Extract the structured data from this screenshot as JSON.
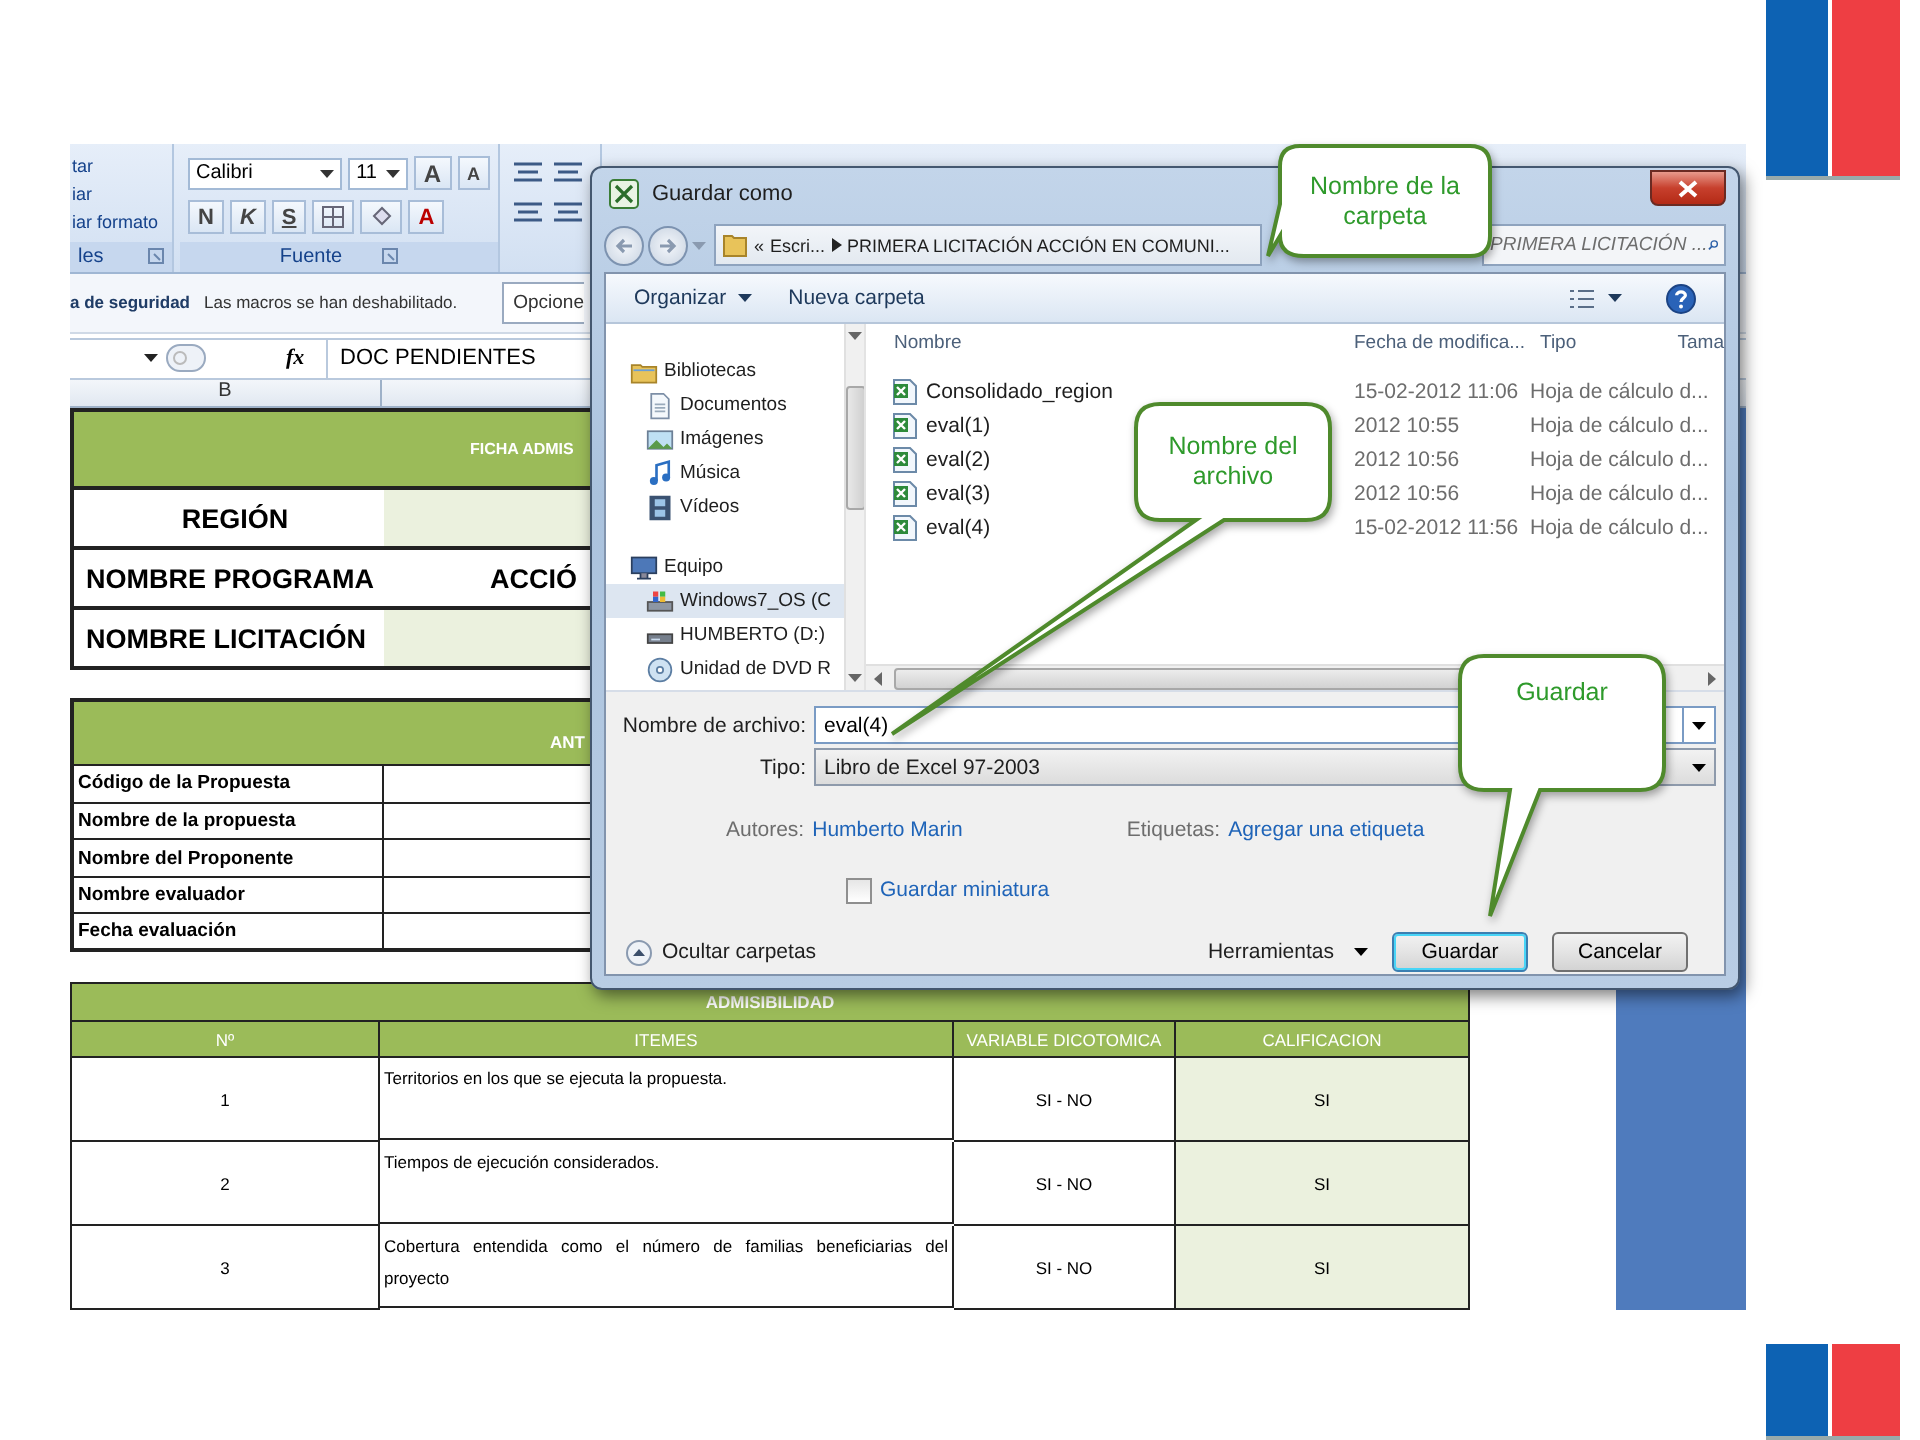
{
  "excel": {
    "ribbon": {
      "clipboard": {
        "items": [
          "tar",
          "iar",
          "iar formato"
        ],
        "label": "les"
      },
      "font": {
        "name": "Calibri",
        "size": "11",
        "grow": "A",
        "shrink": "A",
        "bold": "N",
        "italic": "K",
        "underline": "S",
        "font_color": "A",
        "label": "Fuente"
      }
    },
    "security_bar": {
      "title": "a de seguridad",
      "message": "Las macros se han deshabilitado.",
      "button": "Opcione"
    },
    "formula_bar": {
      "function_label": "fx",
      "content": "DOC PENDIENTES"
    },
    "column_header": "B",
    "ficha": {
      "title": "FICHA ADMIS",
      "rows": [
        {
          "label": "REGIÓN",
          "filled": true
        },
        {
          "label": "NOMBRE PROGRAMA",
          "value": "ACCIÓ",
          "filled": false
        },
        {
          "label": "NOMBRE LICITACIÓN",
          "filled": true
        }
      ]
    },
    "antecedentes": {
      "title": "ANT",
      "rows": [
        "Código de la Propuesta",
        "Nombre de la propuesta",
        "Nombre del Proponente",
        "Nombre evaluador",
        "Fecha evaluación"
      ]
    },
    "admisibilidad": {
      "title": "ADMISIBILIDAD",
      "columns": [
        "Nº",
        "ITEMES",
        "VARIABLE DICOTOMICA",
        "CALIFICACION"
      ],
      "rows": [
        {
          "number": "1",
          "item": "Territorios en los que se ejecuta la propuesta.",
          "variable": "SI - NO",
          "grade": "SI"
        },
        {
          "number": "2",
          "item": "Tiempos de ejecución considerados.",
          "variable": "SI - NO",
          "grade": "SI"
        },
        {
          "number": "3",
          "item": "Cobertura entendida como el número de familias beneficiarias del proyecto",
          "variable": "SI - NO",
          "grade": "SI"
        }
      ]
    }
  },
  "dialog": {
    "title": "Guardar como",
    "address": {
      "overflow": "«",
      "crumbs": [
        "Escri...",
        "PRIMERA LICITACIÓN ACCIÓN EN COMUNI..."
      ]
    },
    "search_placeholder": "PRIMERA LICITACIÓN ...",
    "toolbar": [
      {
        "label": "Organizar",
        "menu": true
      },
      {
        "label": "Nueva carpeta",
        "menu": false
      }
    ],
    "nav": [
      {
        "label": "Bibliotecas",
        "kind": "library",
        "selected": false,
        "children": [
          {
            "label": "Documentos",
            "kind": "documents",
            "selected": false
          },
          {
            "label": "Imágenes",
            "kind": "pictures",
            "selected": false
          },
          {
            "label": "Música",
            "kind": "music",
            "selected": false
          },
          {
            "label": "Vídeos",
            "kind": "videos",
            "selected": false
          }
        ]
      },
      {
        "label": "Equipo",
        "kind": "computer",
        "selected": false,
        "children": [
          {
            "label": "Windows7_OS (C",
            "kind": "system-drive",
            "selected": true
          },
          {
            "label": "HUMBERTO (D:)",
            "kind": "drive",
            "selected": false
          },
          {
            "label": "Unidad de DVD R",
            "kind": "dvd",
            "selected": false
          }
        ]
      }
    ],
    "columns": [
      "Nombre",
      "Fecha de modifica...",
      "Tipo",
      "Tama"
    ],
    "files": [
      {
        "name": "Consolidado_region",
        "modified": "15-02-2012 11:06",
        "type": "Hoja de cálculo d..."
      },
      {
        "name": "eval(1)",
        "modified": "2012 10:55",
        "type": "Hoja de cálculo d..."
      },
      {
        "name": "eval(2)",
        "modified": "2012 10:56",
        "type": "Hoja de cálculo d..."
      },
      {
        "name": "eval(3)",
        "modified": "2012 10:56",
        "type": "Hoja de cálculo d..."
      },
      {
        "name": "eval(4)",
        "modified": "15-02-2012 11:56",
        "type": "Hoja de cálculo d..."
      }
    ],
    "filename_label": "Nombre de archivo:",
    "filename": "eval(4)",
    "type_label": "Tipo:",
    "type_value": "Libro de Excel 97-2003",
    "authors_label": "Autores:",
    "authors": "Humberto Marin",
    "tags_label": "Etiquetas:",
    "tags": "Agregar una etiqueta",
    "thumbnail": {
      "label": "Guardar miniatura",
      "checked": false
    },
    "hide_folders": "Ocultar carpetas",
    "tools": "Herramientas",
    "save": "Guardar",
    "cancel": "Cancelar"
  },
  "callouts": [
    {
      "text": "Nombre de la carpeta"
    },
    {
      "text": "Nombre del archivo"
    },
    {
      "text": "Guardar"
    }
  ]
}
